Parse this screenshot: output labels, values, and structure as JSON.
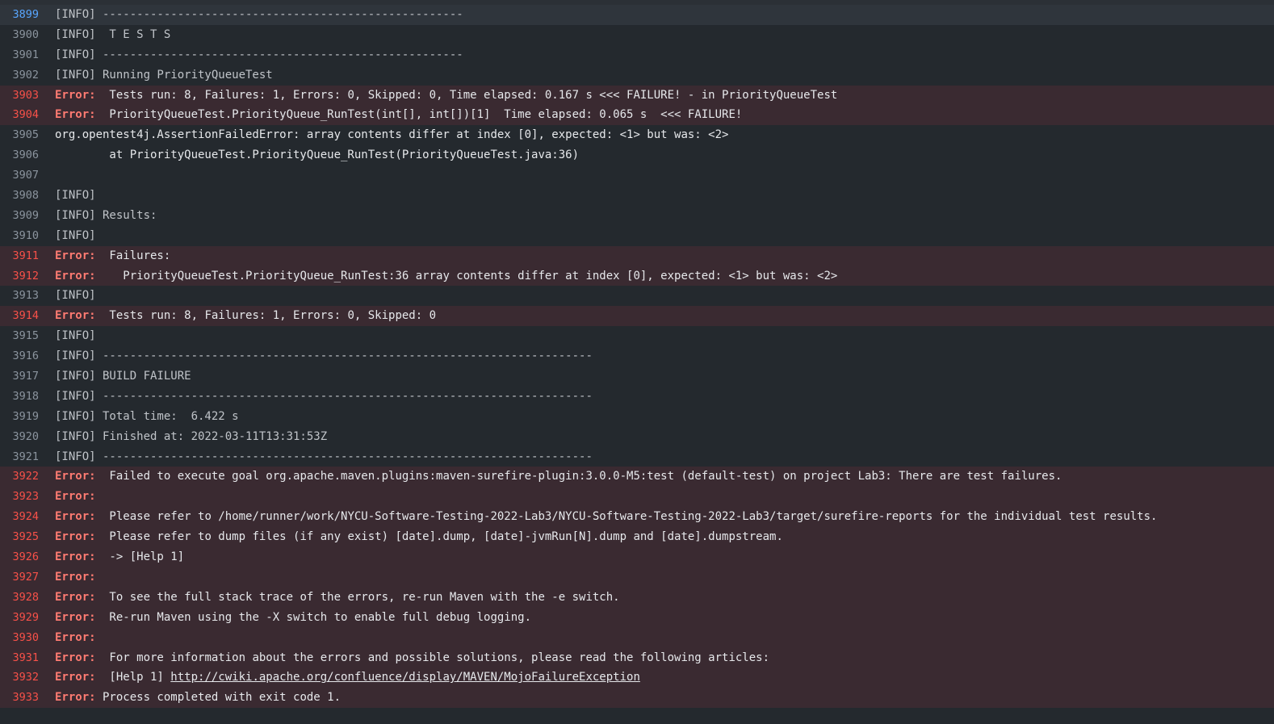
{
  "lines": [
    {
      "num": "3899",
      "kind": "info",
      "text": "[INFO] -----------------------------------------------------",
      "current": true
    },
    {
      "num": "3900",
      "kind": "info",
      "text": "[INFO]  T E S T S"
    },
    {
      "num": "3901",
      "kind": "info",
      "text": "[INFO] -----------------------------------------------------"
    },
    {
      "num": "3902",
      "kind": "info",
      "text": "[INFO] Running PriorityQueueTest"
    },
    {
      "num": "3903",
      "kind": "error",
      "tag": "Error:",
      "text": "  Tests run: 8, Failures: 1, Errors: 0, Skipped: 0, Time elapsed: 0.167 s <<< FAILURE! - in PriorityQueueTest"
    },
    {
      "num": "3904",
      "kind": "error",
      "tag": "Error:",
      "text": "  PriorityQueueTest.PriorityQueue_RunTest(int[], int[])[1]  Time elapsed: 0.065 s  <<< FAILURE!"
    },
    {
      "num": "3905",
      "kind": "plain",
      "text": "org.opentest4j.AssertionFailedError: array contents differ at index [0], expected: <1> but was: <2>"
    },
    {
      "num": "3906",
      "kind": "plain",
      "text": "\tat PriorityQueueTest.PriorityQueue_RunTest(PriorityQueueTest.java:36)"
    },
    {
      "num": "3907",
      "kind": "plain",
      "text": ""
    },
    {
      "num": "3908",
      "kind": "info",
      "text": "[INFO]"
    },
    {
      "num": "3909",
      "kind": "info",
      "text": "[INFO] Results:"
    },
    {
      "num": "3910",
      "kind": "info",
      "text": "[INFO]"
    },
    {
      "num": "3911",
      "kind": "error",
      "tag": "Error:",
      "text": "  Failures:"
    },
    {
      "num": "3912",
      "kind": "error",
      "tag": "Error:",
      "text": "    PriorityQueueTest.PriorityQueue_RunTest:36 array contents differ at index [0], expected: <1> but was: <2>"
    },
    {
      "num": "3913",
      "kind": "info",
      "text": "[INFO]"
    },
    {
      "num": "3914",
      "kind": "error",
      "tag": "Error:",
      "text": "  Tests run: 8, Failures: 1, Errors: 0, Skipped: 0"
    },
    {
      "num": "3915",
      "kind": "info",
      "text": "[INFO]"
    },
    {
      "num": "3916",
      "kind": "info",
      "text": "[INFO] ------------------------------------------------------------------------"
    },
    {
      "num": "3917",
      "kind": "info",
      "text": "[INFO] BUILD FAILURE"
    },
    {
      "num": "3918",
      "kind": "info",
      "text": "[INFO] ------------------------------------------------------------------------"
    },
    {
      "num": "3919",
      "kind": "info",
      "text": "[INFO] Total time:  6.422 s"
    },
    {
      "num": "3920",
      "kind": "info",
      "text": "[INFO] Finished at: 2022-03-11T13:31:53Z"
    },
    {
      "num": "3921",
      "kind": "info",
      "text": "[INFO] ------------------------------------------------------------------------"
    },
    {
      "num": "3922",
      "kind": "error",
      "tag": "Error:",
      "text": "  Failed to execute goal org.apache.maven.plugins:maven-surefire-plugin:3.0.0-M5:test (default-test) on project Lab3: There are test failures."
    },
    {
      "num": "3923",
      "kind": "error",
      "tag": "Error:",
      "text": ""
    },
    {
      "num": "3924",
      "kind": "error",
      "tag": "Error:",
      "text": "  Please refer to /home/runner/work/NYCU-Software-Testing-2022-Lab3/NYCU-Software-Testing-2022-Lab3/target/surefire-reports for the individual test results."
    },
    {
      "num": "3925",
      "kind": "error",
      "tag": "Error:",
      "text": "  Please refer to dump files (if any exist) [date].dump, [date]-jvmRun[N].dump and [date].dumpstream."
    },
    {
      "num": "3926",
      "kind": "error",
      "tag": "Error:",
      "text": "  -> [Help 1]"
    },
    {
      "num": "3927",
      "kind": "error",
      "tag": "Error:",
      "text": ""
    },
    {
      "num": "3928",
      "kind": "error",
      "tag": "Error:",
      "text": "  To see the full stack trace of the errors, re-run Maven with the -e switch."
    },
    {
      "num": "3929",
      "kind": "error",
      "tag": "Error:",
      "text": "  Re-run Maven using the -X switch to enable full debug logging."
    },
    {
      "num": "3930",
      "kind": "error",
      "tag": "Error:",
      "text": ""
    },
    {
      "num": "3931",
      "kind": "error",
      "tag": "Error:",
      "text": "  For more information about the errors and possible solutions, please read the following articles:"
    },
    {
      "num": "3932",
      "kind": "error",
      "tag": "Error:",
      "text": "  [Help 1] ",
      "link": "http://cwiki.apache.org/confluence/display/MAVEN/MojoFailureException"
    },
    {
      "num": "3933",
      "kind": "error",
      "tag": "Error:",
      "text": " Process completed with exit code 1."
    }
  ],
  "colors": {
    "background": "#24292e",
    "error_row": "#3a2a31",
    "error_text": "#ff7b72",
    "line_number": "#8b949e",
    "current_line_number": "#58a6ff"
  }
}
